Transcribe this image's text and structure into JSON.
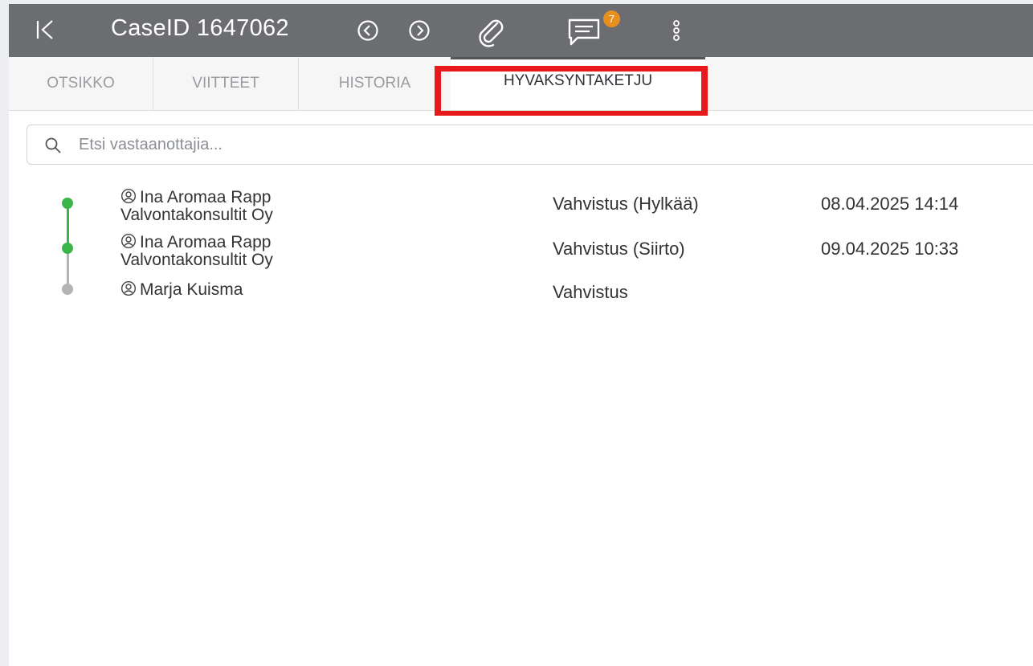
{
  "header": {
    "case_title": "CaseID 1647062",
    "comments_badge": "7",
    "bg_color": "#6c6d70",
    "badge_color": "#e8901f"
  },
  "tabs": [
    {
      "label": "OTSIKKO"
    },
    {
      "label": "VIITTEET"
    },
    {
      "label": "HISTORIA"
    },
    {
      "label": "HYVAKSYNTAKETJU",
      "active": true
    }
  ],
  "search": {
    "placeholder": "Etsi vastaanottajia...",
    "value": ""
  },
  "approvals": [
    {
      "name": "Ina Aromaa Rapp",
      "company": "Valvontakonsultit Oy",
      "step": "Vahvistus (Hylkää)",
      "date": "08.04.2025 14:14",
      "status_color": "#3bb54a"
    },
    {
      "name": "Ina Aromaa Rapp",
      "company": "Valvontakonsultit Oy",
      "step": "Vahvistus (Siirto)",
      "date": "09.04.2025 10:33",
      "status_color": "#3bb54a"
    },
    {
      "name": "Marja Kuisma",
      "company": "",
      "step": "Vahvistus",
      "date": "",
      "status_color": "#b3b4b6"
    }
  ],
  "highlight_color": "#e8191b"
}
